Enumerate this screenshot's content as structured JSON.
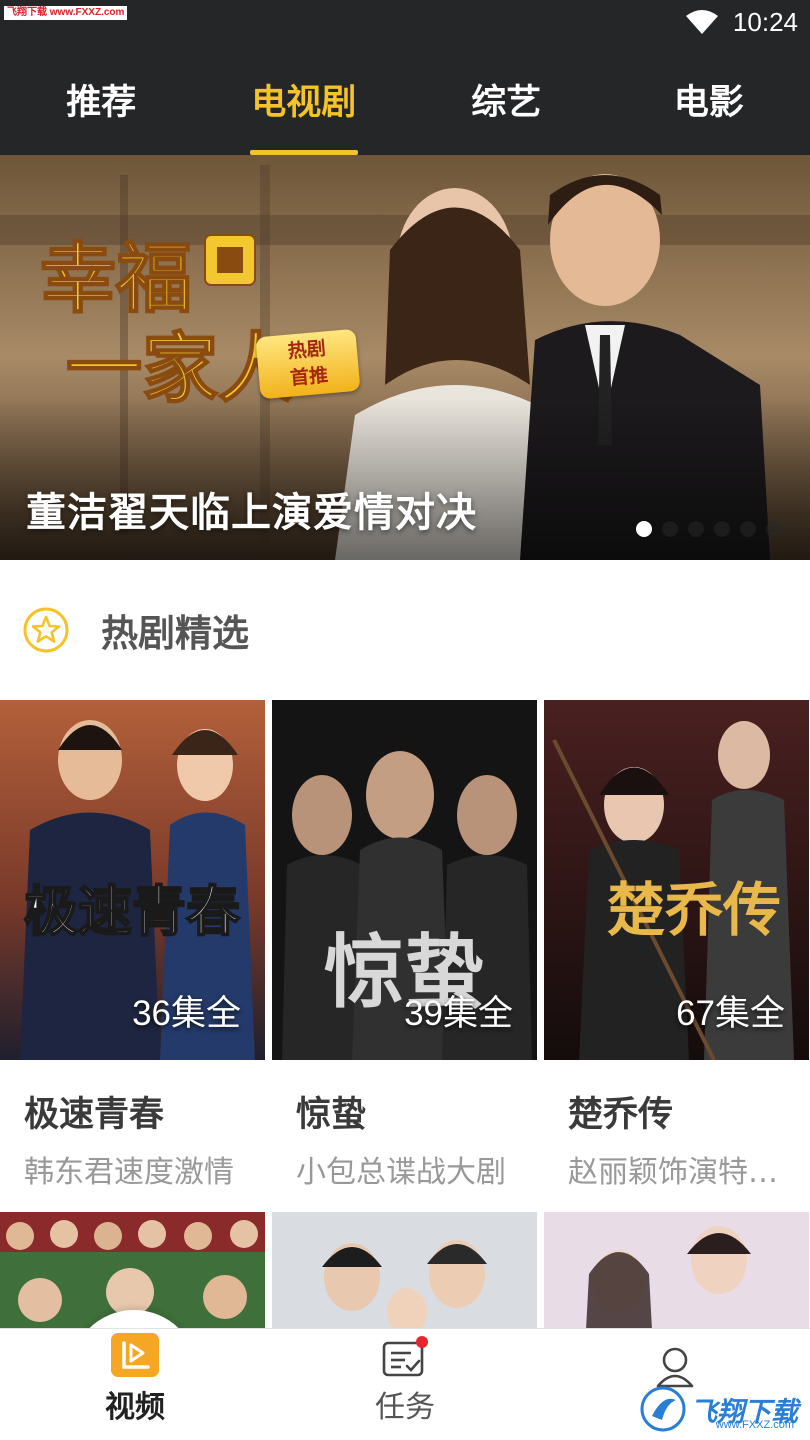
{
  "status_bar": {
    "watermark": "飞翔下载 www.FXXZ.com",
    "time": "10:24"
  },
  "tabs": [
    {
      "label": "推荐",
      "active": false
    },
    {
      "label": "电视剧",
      "active": true
    },
    {
      "label": "综艺",
      "active": false
    },
    {
      "label": "电影",
      "active": false
    }
  ],
  "banner": {
    "logo_text_line1": "幸福",
    "logo_text_line2": "一家人",
    "tag_line1": "热剧",
    "tag_line2": "首推",
    "caption": "董洁翟天临上演爱情对决",
    "page_count": 6,
    "current_page": 1
  },
  "section": {
    "title": "热剧精选",
    "icon": "star-icon"
  },
  "cards": [
    {
      "title": "极速青春",
      "subtitle": "韩东君速度激情",
      "episodes": "36集全",
      "poster_title": "极速青春"
    },
    {
      "title": "惊蛰",
      "subtitle": "小包总谍战大剧",
      "episodes": "39集全",
      "poster_title": "惊蛰"
    },
    {
      "title": "楚乔传",
      "subtitle": "赵丽颖饰演特…",
      "episodes": "67集全",
      "poster_title": "楚乔传"
    }
  ],
  "bottom_nav": [
    {
      "label": "视频",
      "icon": "video-icon",
      "active": true
    },
    {
      "label": "任务",
      "icon": "task-icon",
      "active": false
    },
    {
      "label": "",
      "icon": "user-icon",
      "active": false
    }
  ],
  "brand_watermark": {
    "name": "飞翔下载",
    "url": "www.FXXZ.com"
  },
  "colors": {
    "accent": "#f5c328",
    "topbar": "#252628",
    "badge_red": "#e8242c"
  }
}
